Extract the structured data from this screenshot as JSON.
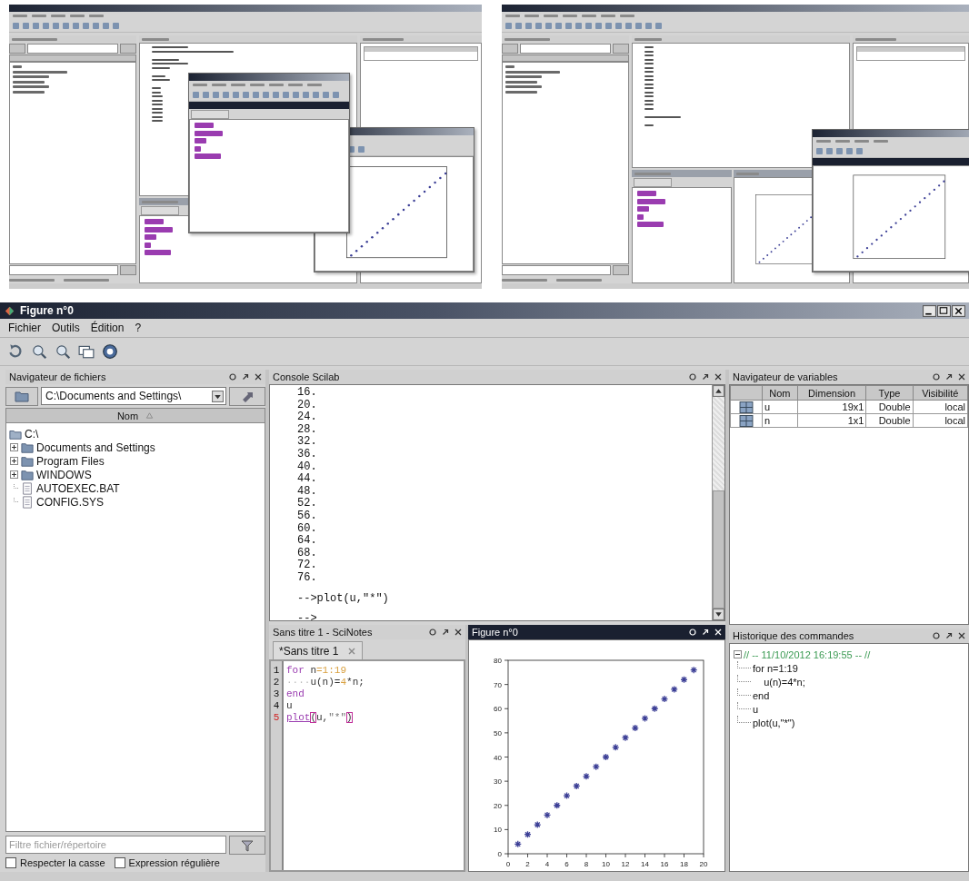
{
  "window": {
    "title": "Figure n°0"
  },
  "menu": [
    "Fichier",
    "Outils",
    "Édition",
    "?"
  ],
  "file_browser": {
    "title": "Navigateur de fichiers",
    "path": "C:\\Documents and Settings\\",
    "column": "Nom",
    "tree": {
      "label": "C:\\",
      "kind": "folder",
      "expanded": true,
      "children": [
        {
          "label": "Documents and Settings",
          "kind": "folder",
          "expanded": false
        },
        {
          "label": "Program Files",
          "kind": "folder",
          "expanded": false
        },
        {
          "label": "WINDOWS",
          "kind": "folder",
          "expanded": false
        },
        {
          "label": "AUTOEXEC.BAT",
          "kind": "file"
        },
        {
          "label": "CONFIG.SYS",
          "kind": "file"
        }
      ]
    },
    "filter_placeholder": "Filtre fichier/répertoire",
    "options": [
      {
        "label": "Respecter la casse",
        "checked": false
      },
      {
        "label": "Expression régulière",
        "checked": false
      }
    ]
  },
  "console": {
    "title": "Console Scilab",
    "lines": [
      {
        "text": "16.",
        "gap_before": false
      },
      {
        "text": "20.",
        "gap_before": false
      },
      {
        "text": "24.",
        "gap_before": false
      },
      {
        "text": "28.",
        "gap_before": false
      },
      {
        "text": "32.",
        "gap_before": false
      },
      {
        "text": "36.",
        "gap_before": false
      },
      {
        "text": "40.",
        "gap_before": false
      },
      {
        "text": "44.",
        "gap_before": false
      },
      {
        "text": "48.",
        "gap_before": false
      },
      {
        "text": "52.",
        "gap_before": false
      },
      {
        "text": "56.",
        "gap_before": false
      },
      {
        "text": "60.",
        "gap_before": false
      },
      {
        "text": "64.",
        "gap_before": false
      },
      {
        "text": "68.",
        "gap_before": false
      },
      {
        "text": "72.",
        "gap_before": false
      },
      {
        "text": "76.",
        "gap_before": false
      },
      {
        "text": "-->plot(u,\"*\")",
        "gap_before": true
      },
      {
        "text": "-->",
        "gap_before": true
      }
    ]
  },
  "variables": {
    "title": "Navigateur de variables",
    "columns": [
      "Nom",
      "Dimension",
      "Type",
      "Visibilité"
    ],
    "rows": [
      [
        "u",
        "19x1",
        "Double",
        "local"
      ],
      [
        "n",
        "1x1",
        "Double",
        "local"
      ]
    ]
  },
  "scinotes": {
    "title": "Sans titre 1 - SciNotes",
    "focused": false,
    "tab": "*Sans titre 1",
    "code": [
      {
        "number": "1",
        "current": false,
        "tokens": [
          {
            "kind": "keyword",
            "text": "for"
          },
          {
            "kind": "plain",
            "text": " n"
          },
          {
            "kind": "number",
            "text": "=1:19"
          }
        ]
      },
      {
        "number": "2",
        "current": false,
        "tokens": [
          {
            "kind": "space",
            "text": "····"
          },
          {
            "kind": "plain",
            "text": "u(n)="
          },
          {
            "kind": "number",
            "text": "4"
          },
          {
            "kind": "plain",
            "text": "*n;"
          }
        ]
      },
      {
        "number": "3",
        "current": false,
        "tokens": [
          {
            "kind": "keyword",
            "text": "end"
          }
        ]
      },
      {
        "number": "4",
        "current": false,
        "tokens": [
          {
            "kind": "plain",
            "text": "u"
          }
        ]
      },
      {
        "number": "5",
        "current": true,
        "tokens": [
          {
            "kind": "function",
            "text": "plot"
          },
          {
            "kind": "bracket",
            "text": "("
          },
          {
            "kind": "plain",
            "text": "u,"
          },
          {
            "kind": "string",
            "text": "\"*\""
          },
          {
            "kind": "bracket",
            "text": ")"
          }
        ]
      }
    ]
  },
  "figure": {
    "title": "Figure n°0",
    "focused": true,
    "chart_data": {
      "type": "scatter",
      "x": [
        1,
        2,
        3,
        4,
        5,
        6,
        7,
        8,
        9,
        10,
        11,
        12,
        13,
        14,
        15,
        16,
        17,
        18,
        19
      ],
      "series": [
        {
          "color": "#3c3f96",
          "values": [
            4,
            8,
            12,
            16,
            20,
            24,
            28,
            32,
            36,
            40,
            44,
            48,
            52,
            56,
            60,
            64,
            68,
            72,
            76
          ]
        }
      ],
      "xlim": [
        0,
        20
      ],
      "ylim": [
        0,
        80
      ],
      "xticks": [
        0,
        2,
        4,
        6,
        8,
        10,
        12,
        14,
        16,
        18,
        20
      ],
      "yticks": [
        0,
        10,
        20,
        30,
        40,
        50,
        60,
        70,
        80
      ]
    }
  },
  "history": {
    "title": "Historique des commandes",
    "session": "// -- 11/10/2012 16:19:55 -- //",
    "expanded": true,
    "commands": [
      "for n=1:19",
      "    u(n)=4*n;",
      "end",
      "u",
      "plot(u,\"*\")"
    ]
  }
}
